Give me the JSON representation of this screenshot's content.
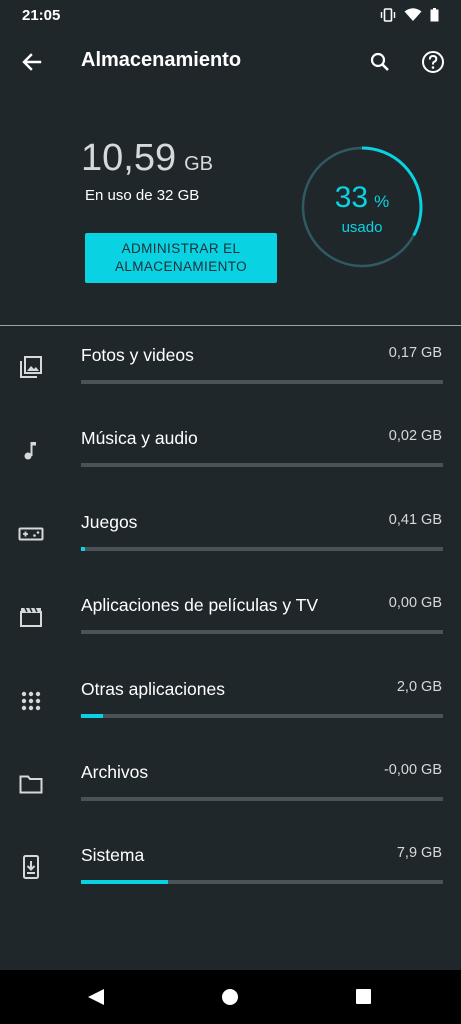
{
  "status_bar": {
    "time": "21:05",
    "icons": [
      "vibrate-icon",
      "wifi-icon",
      "battery-icon"
    ]
  },
  "app_bar": {
    "title": "Almacenamiento",
    "icons": [
      "back-arrow-icon",
      "search-icon",
      "help-icon"
    ]
  },
  "summary": {
    "used_value": "10,59",
    "used_unit": "GB",
    "used_of": "En uso de 32 GB",
    "manage_button_label": "ADMINISTRAR EL ALMACENAMIENTO",
    "percent": "33",
    "percent_symbol": "%",
    "percent_label": "usado",
    "percent_fraction": 0.33
  },
  "categories": [
    {
      "label": "Fotos y videos",
      "size": "0,17 GB",
      "fraction": 0.0,
      "icon": "photo-library-icon"
    },
    {
      "label": "Música y audio",
      "size": "0,02 GB",
      "fraction": 0.0,
      "icon": "music-note-icon"
    },
    {
      "label": "Juegos",
      "size": "0,41 GB",
      "fraction": 0.012,
      "icon": "gamepad-icon"
    },
    {
      "label": "Aplicaciones de películas y TV",
      "size": "0,00 GB",
      "fraction": 0.0,
      "icon": "movie-icon"
    },
    {
      "label": "Otras aplicaciones",
      "size": "2,0 GB",
      "fraction": 0.062,
      "icon": "apps-grid-icon"
    },
    {
      "label": "Archivos",
      "size": "-0,00 GB",
      "fraction": 0.0,
      "icon": "folder-icon"
    },
    {
      "label": "Sistema",
      "size": "7,9 GB",
      "fraction": 0.24,
      "icon": "system-update-icon"
    }
  ],
  "colors": {
    "background": "#20272b",
    "accent": "#09d3e3",
    "track": "#4a5458",
    "ring_track": "#2f5a62"
  },
  "nav_bar": {
    "icons": [
      "nav-back-icon",
      "nav-home-icon",
      "nav-recents-icon"
    ]
  }
}
